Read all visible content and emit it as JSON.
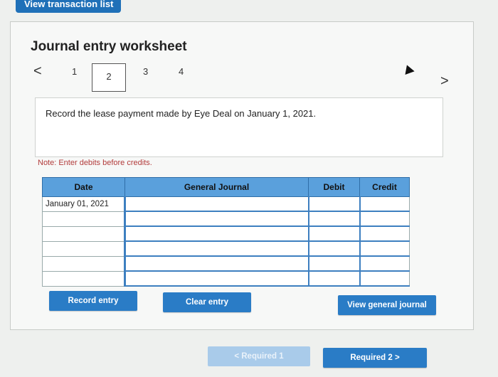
{
  "top_button": "View transaction list",
  "title": "Journal entry worksheet",
  "nav": {
    "prev": "<",
    "next": ">",
    "steps": [
      "1",
      "2",
      "3",
      "4"
    ],
    "active_step": "2"
  },
  "instruction": "Record the lease payment made by Eye Deal on January 1, 2021.",
  "note": "Note: Enter debits before credits.",
  "table": {
    "headers": {
      "date": "Date",
      "journal": "General Journal",
      "debit": "Debit",
      "credit": "Credit"
    },
    "rows": [
      {
        "date": "January 01, 2021",
        "journal": "",
        "debit": "",
        "credit": ""
      },
      {
        "date": "",
        "journal": "",
        "debit": "",
        "credit": ""
      },
      {
        "date": "",
        "journal": "",
        "debit": "",
        "credit": ""
      },
      {
        "date": "",
        "journal": "",
        "debit": "",
        "credit": ""
      },
      {
        "date": "",
        "journal": "",
        "debit": "",
        "credit": ""
      },
      {
        "date": "",
        "journal": "",
        "debit": "",
        "credit": ""
      }
    ]
  },
  "buttons": {
    "record": "Record entry",
    "clear": "Clear entry",
    "view_gj": "View general journal",
    "required1": "< Required 1",
    "required2": "Required 2  >"
  },
  "colors": {
    "accent": "#2a7cc6",
    "header": "#5aa0dc",
    "note": "#b23b3b"
  }
}
